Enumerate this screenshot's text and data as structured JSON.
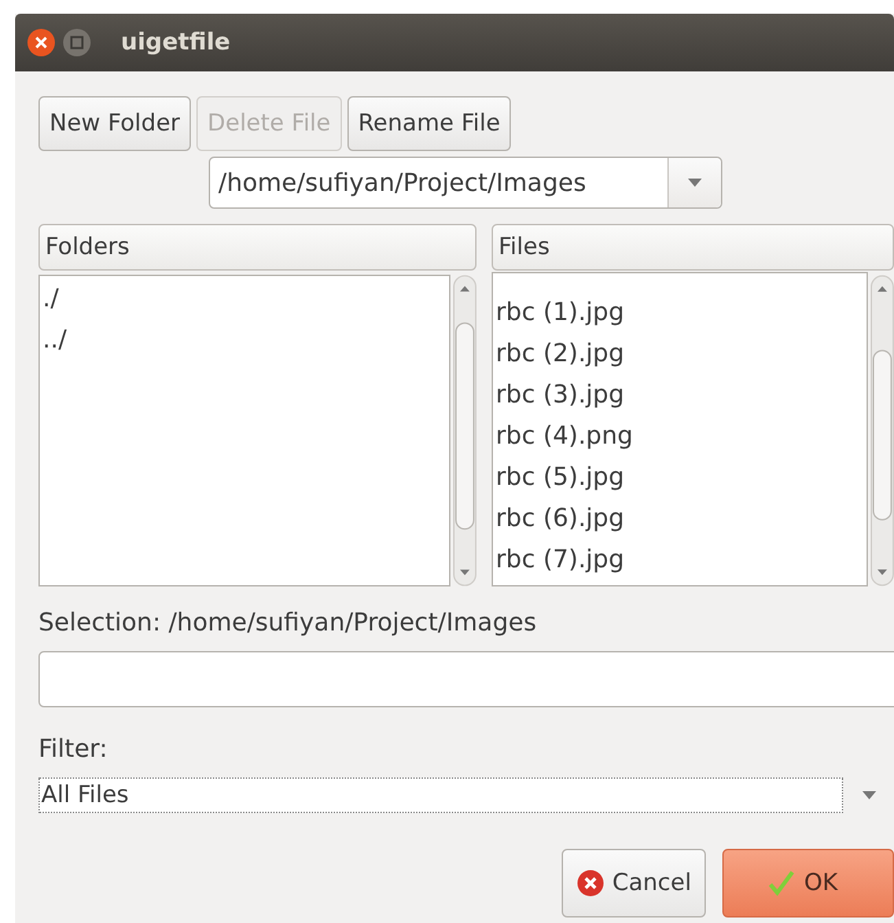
{
  "window": {
    "title": "uigetfile"
  },
  "toolbar": [
    {
      "label": "New Folder",
      "disabled": false
    },
    {
      "label": "Delete File",
      "disabled": true
    },
    {
      "label": "Rename File",
      "disabled": false
    }
  ],
  "path_combo": {
    "value": "/home/sufiyan/Project/Images"
  },
  "folders": {
    "header": "Folders",
    "items": [
      "./",
      "../"
    ]
  },
  "files": {
    "header": "Files",
    "items": [
      "rbc (1).jpg",
      "rbc (2).jpg",
      "rbc (3).jpg",
      "rbc (4).png",
      "rbc (5).jpg",
      "rbc (6).jpg",
      "rbc (7).jpg"
    ]
  },
  "selection": {
    "label": "Selection: /home/sufiyan/Project/Images"
  },
  "filter": {
    "label": "Filter:",
    "value": "All Files"
  },
  "buttons": [
    {
      "label": "Cancel",
      "kind": "cancel"
    },
    {
      "label": "OK",
      "kind": "ok"
    }
  ]
}
